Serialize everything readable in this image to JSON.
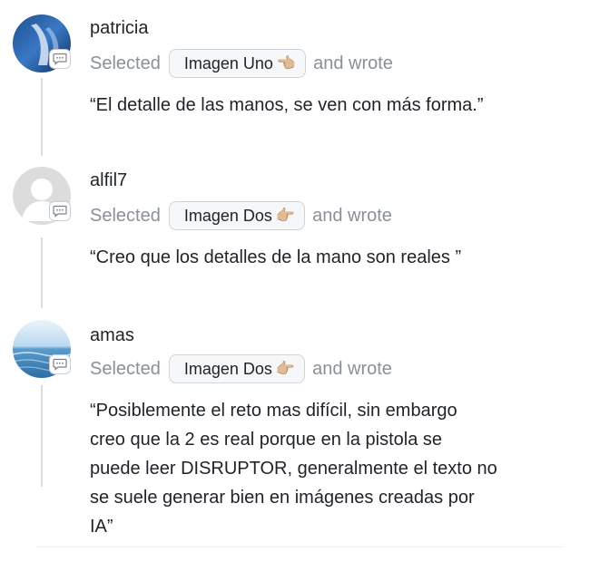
{
  "comments": [
    {
      "username": "patricia",
      "selected_label": "Selected",
      "chip_label": "Imagen Uno",
      "chip_emoji": "👈🏼",
      "wrote_label": "and wrote",
      "quote": "“El detalle de las manos, se ven con más forma.”"
    },
    {
      "username": "alfil7",
      "selected_label": "Selected",
      "chip_label": "Imagen Dos",
      "chip_emoji": "👉🏼",
      "wrote_label": "and wrote",
      "quote": "“Creo que los detalles de la mano son reales ”"
    },
    {
      "username": "amas",
      "selected_label": "Selected",
      "chip_label": "Imagen Dos",
      "chip_emoji": "👉🏼",
      "wrote_label": "and wrote",
      "quote_lines": [
        "“Posiblemente el reto mas difícil, sin embargo",
        "creo que la 2 es real porque en la pistola se",
        "puede leer DISRUPTOR, generalmente el texto no",
        "se suele generar bien en imágenes creadas por",
        "IA”"
      ]
    }
  ],
  "colors": {
    "muted_text": "#8a9099",
    "thread_line": "#d8dce2",
    "chip_border": "#cfd4da"
  },
  "icons": [
    "avatar-photo-icon",
    "default-avatar-icon",
    "comment-bubble-icon"
  ]
}
